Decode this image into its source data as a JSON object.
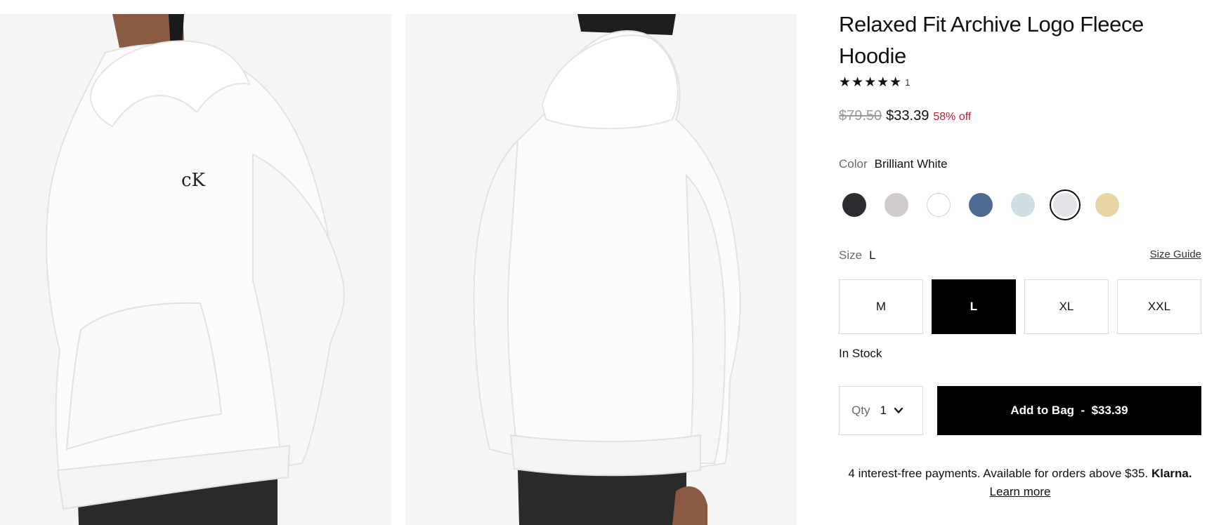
{
  "product": {
    "title": "Relaxed Fit Archive Logo Fleece Hoodie",
    "stars": "★★★★★",
    "rating_value": 5,
    "review_count": "1",
    "original_price": "$79.50",
    "sale_price": "$33.39",
    "discount": "58% off"
  },
  "color": {
    "label": "Color",
    "selected": "Brilliant White",
    "swatches": [
      {
        "name": "black-swatch",
        "hex": "#2b2c30"
      },
      {
        "name": "light-grey-swatch",
        "hex": "#cfcacb"
      },
      {
        "name": "white-swatch",
        "hex": "#ffffff"
      },
      {
        "name": "denim-blue-swatch",
        "hex": "#4d6a93"
      },
      {
        "name": "pale-blue-swatch",
        "hex": "#cfdde4"
      },
      {
        "name": "brilliant-white-swatch",
        "hex": "#e3e3ea"
      },
      {
        "name": "sand-swatch",
        "hex": "#e9d6a6"
      }
    ]
  },
  "size": {
    "label": "Size",
    "selected": "L",
    "guide_label": "Size Guide",
    "options": [
      "M",
      "L",
      "XL",
      "XXL"
    ]
  },
  "stock_status": "In Stock",
  "qty": {
    "label": "Qty",
    "value": "1"
  },
  "add_to_bag_label": "Add to Bag  -  $33.39",
  "klarna": {
    "text": "4 interest-free payments. Available for orders above $35.",
    "brand": "Klarna.",
    "learn_more": "Learn more"
  },
  "images": {
    "front_logo": "cK"
  }
}
